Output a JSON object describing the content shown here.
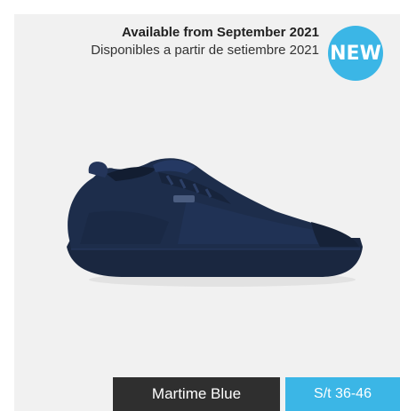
{
  "announcement": {
    "title": "Available from September 2021",
    "subtitle": "Disponibles a partir de setiembre 2021"
  },
  "badge": {
    "text": "NEW",
    "color": "#3bb6e6"
  },
  "product": {
    "image_icon": "sneaker-image",
    "color_name": "Martime Blue",
    "size_range": "S/t 36-46",
    "shoe_color": "#1c2a44"
  },
  "colors": {
    "background": "#f1f1f1",
    "name_label_bg": "#2f2f2f",
    "accent": "#3bb6e6"
  }
}
